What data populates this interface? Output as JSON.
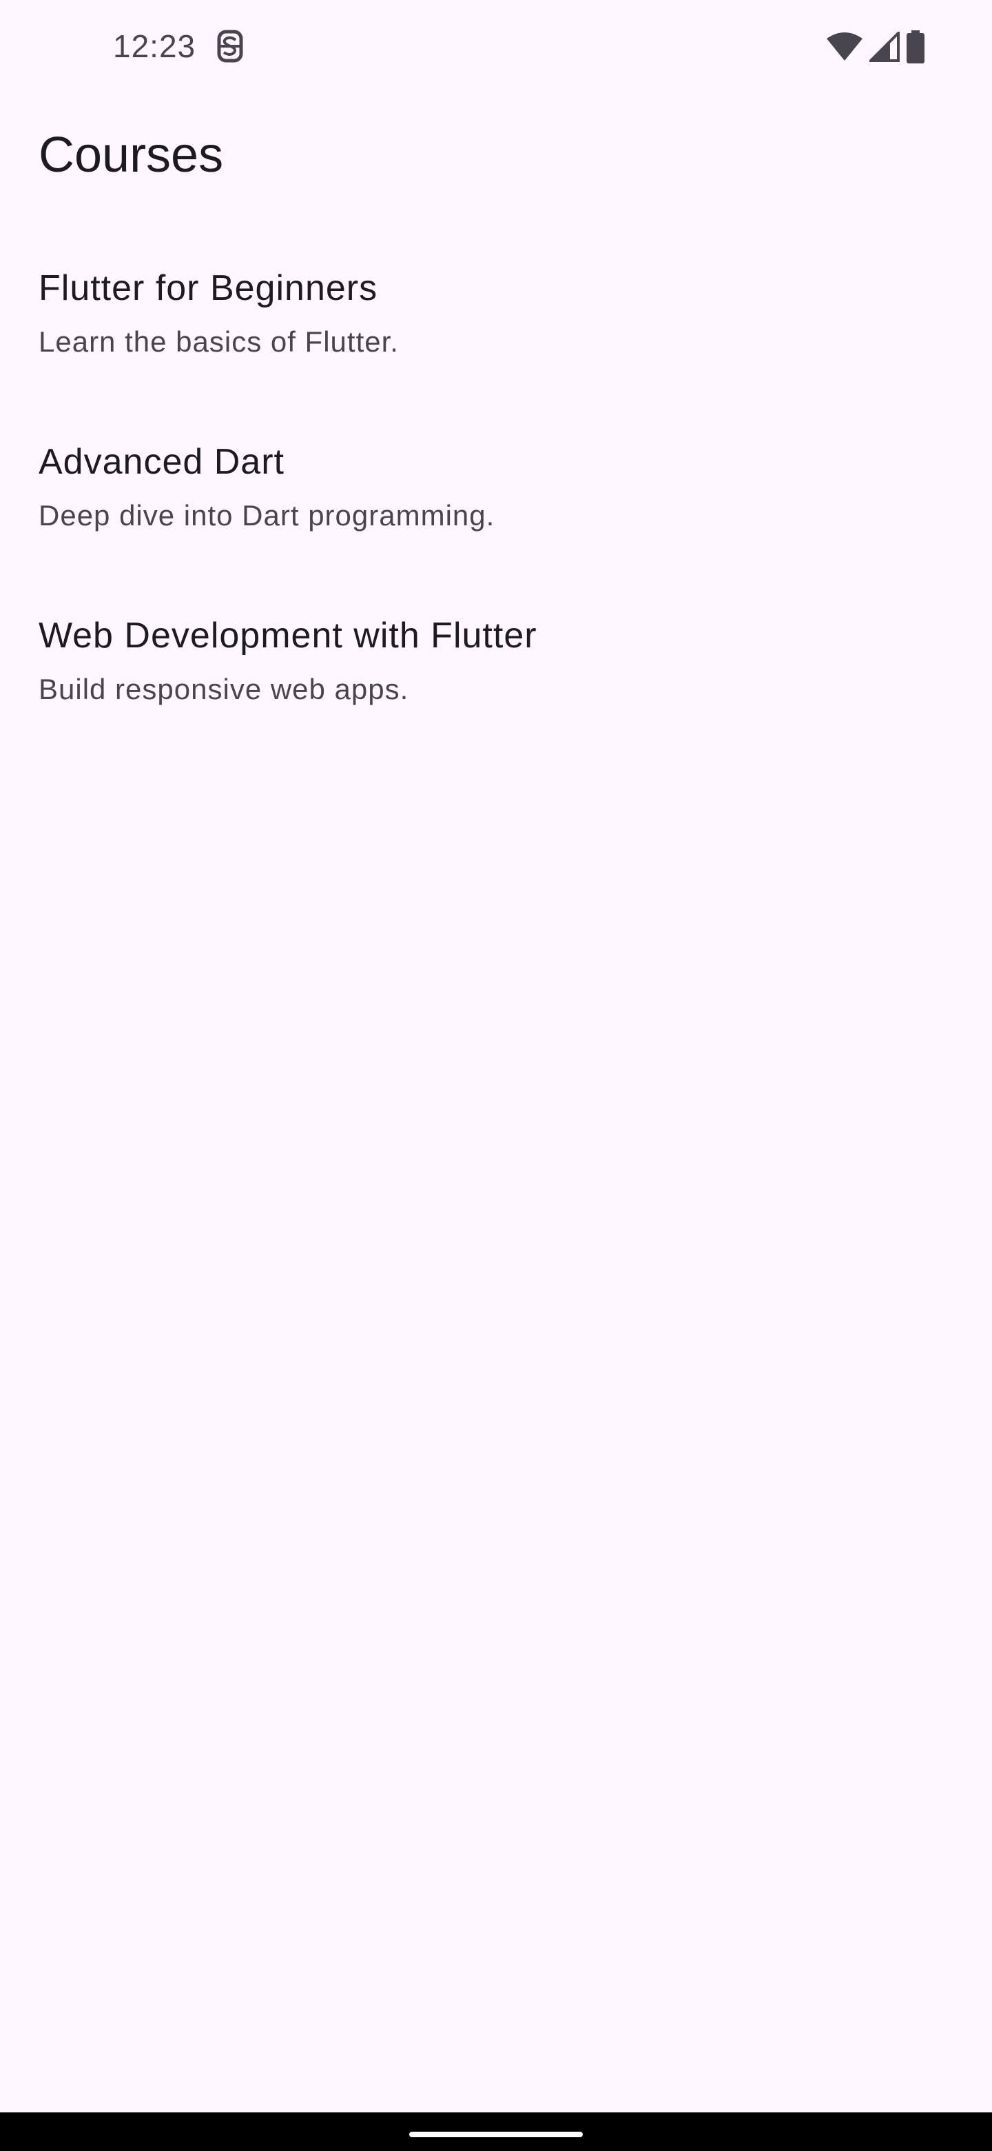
{
  "status_bar": {
    "time": "12:23",
    "left_icon": "sim-s-icon",
    "right_icons": [
      "wifi-icon",
      "cellular-signal-icon",
      "battery-icon"
    ]
  },
  "app_bar": {
    "title": "Courses"
  },
  "courses": [
    {
      "title": "Flutter for Beginners",
      "subtitle": "Learn the basics of Flutter."
    },
    {
      "title": "Advanced Dart",
      "subtitle": "Deep dive into Dart programming."
    },
    {
      "title": "Web Development with Flutter",
      "subtitle": "Build responsive web apps."
    }
  ],
  "colors": {
    "background": "#fef7fd",
    "primary_text": "#1d1b20",
    "secondary_text": "#49454f",
    "nav_bar": "#000000"
  }
}
